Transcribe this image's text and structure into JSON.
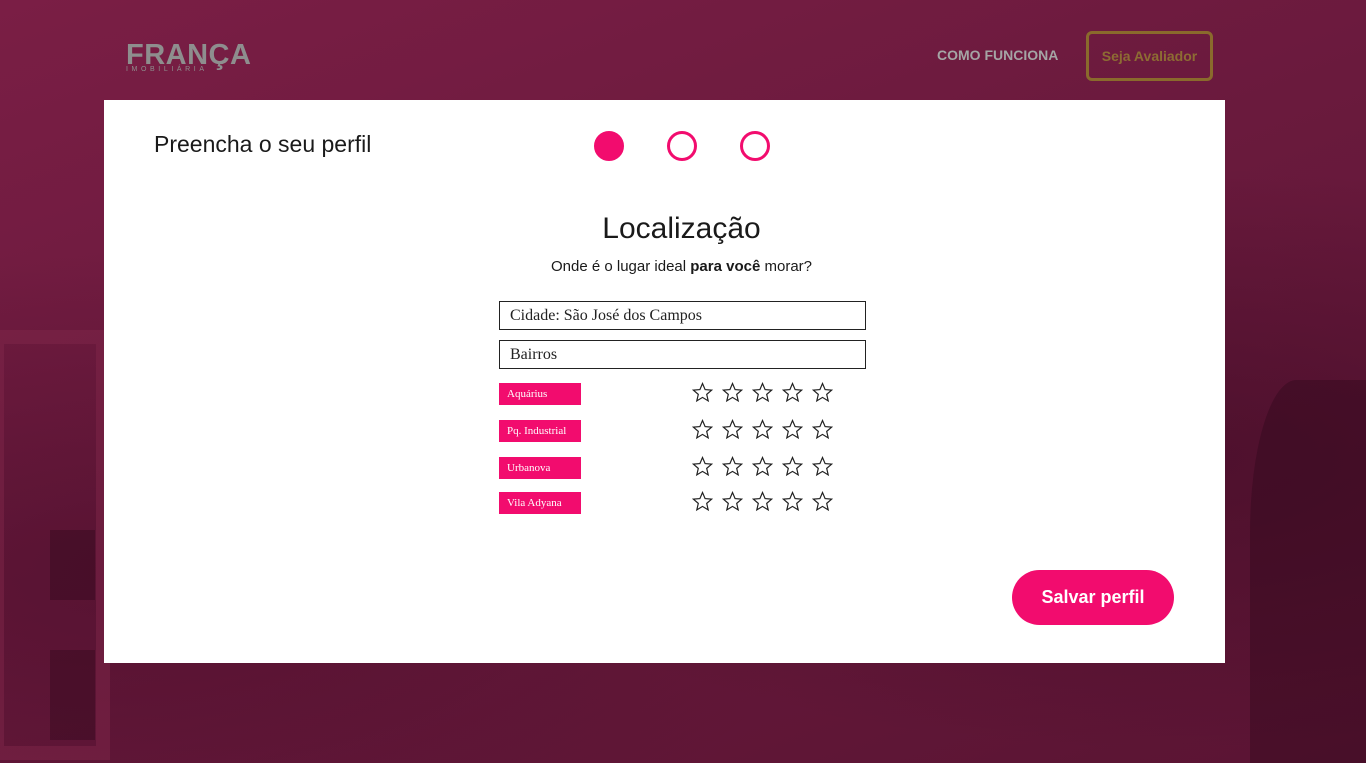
{
  "header": {
    "logo_main": "FRANÇA",
    "logo_sub": "IMOBILIÁRIA",
    "nav_link": "COMO FUNCIONA",
    "nav_button": "Seja Avaliador"
  },
  "card": {
    "title": "Preencha o seu perfil",
    "steps": {
      "total": 3,
      "current": 1
    },
    "section_title": "Localização",
    "subtitle_prefix": "Onde é o lugar ideal ",
    "subtitle_bold": "para você",
    "subtitle_suffix": " morar?",
    "city_field": "Cidade: São José dos Campos",
    "neighborhoods_field": "Bairros",
    "neighborhoods": [
      {
        "name": "Aquárius",
        "rating": 0,
        "max": 5
      },
      {
        "name": "Pq. Industrial",
        "rating": 0,
        "max": 5
      },
      {
        "name": "Urbanova",
        "rating": 0,
        "max": 5
      },
      {
        "name": "Vila Adyana",
        "rating": 0,
        "max": 5
      }
    ],
    "save_button": "Salvar perfil"
  },
  "colors": {
    "accent": "#f20c6e",
    "background": "#6a1a3d",
    "nav_button_border": "#8a6a2c"
  },
  "icons": {
    "star": "star-outline-icon"
  }
}
